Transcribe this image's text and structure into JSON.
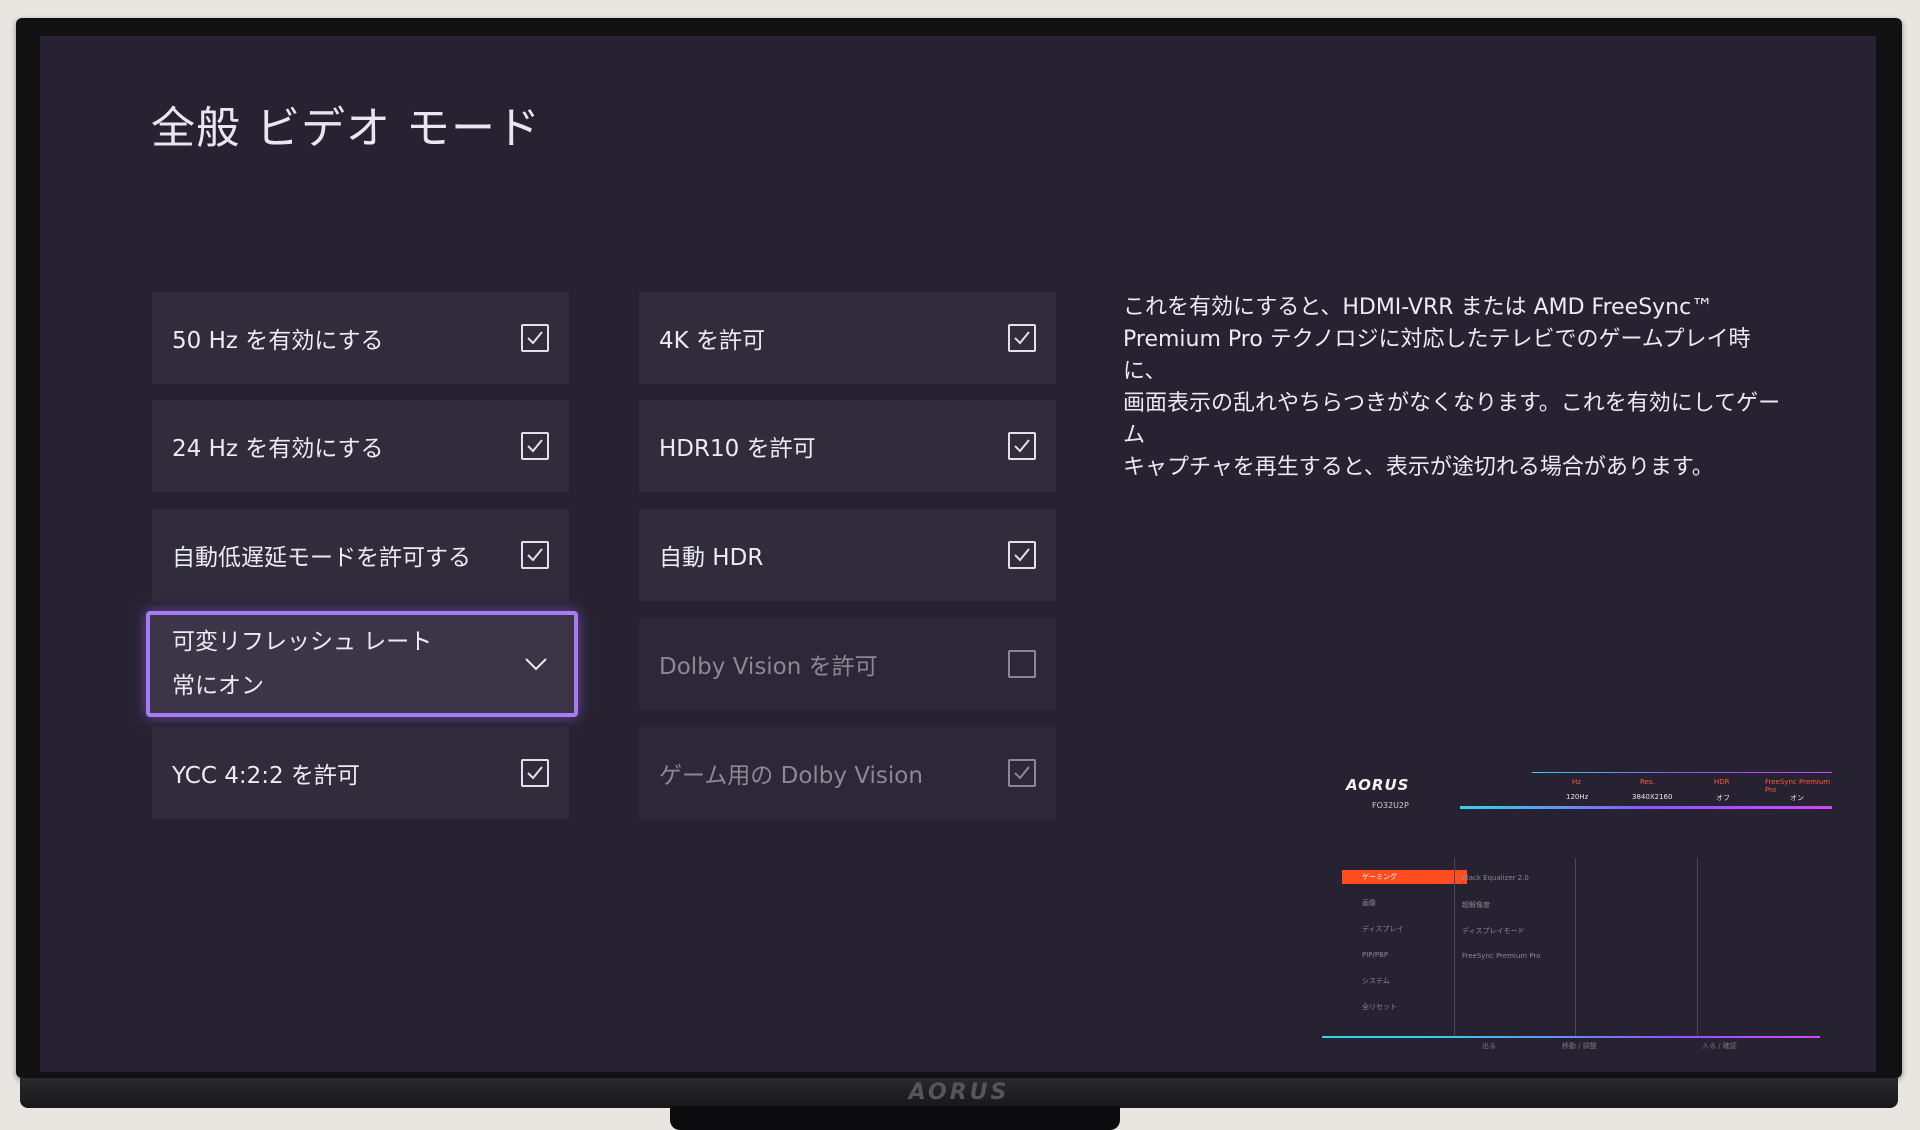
{
  "page": {
    "title": "全般 ビデオ モード"
  },
  "left_column": [
    {
      "label": "50 Hz を有効にする",
      "checked": true
    },
    {
      "label": "24 Hz を有効にする",
      "checked": true
    },
    {
      "label": "自動低遅延モードを許可する",
      "checked": true
    }
  ],
  "vrr_dropdown": {
    "label": "可変リフレッシュ レート",
    "value": "常にオン"
  },
  "ycc_option": {
    "label": "YCC 4:2:2 を許可",
    "checked": true
  },
  "right_column": [
    {
      "label": "4K を許可",
      "checked": true
    },
    {
      "label": "HDR10 を許可",
      "checked": true
    },
    {
      "label": "自動 HDR",
      "checked": true
    },
    {
      "label": "Dolby Vision を許可",
      "checked": false,
      "disabled": true
    },
    {
      "label": "ゲーム用の Dolby Vision",
      "checked": true,
      "disabled": true
    }
  ],
  "description": {
    "lines": [
      "これを有効にすると、HDMI-VRR または AMD FreeSync™",
      "Premium Pro テクノロジに対応したテレビでのゲームプレイ時に、",
      "画面表示の乱れやちらつきがなくなります。これを有効にしてゲーム",
      "キャプチャを再生すると、表示が途切れる場合があります。"
    ]
  },
  "monitor": {
    "brand": "AORUS",
    "osd": {
      "logo": "AORUS",
      "model": "FO32U2P",
      "status_headers": [
        "Hz",
        "Res.",
        "HDR",
        "FreeSync Premium Pro"
      ],
      "status_values": [
        "120Hz",
        "3840X2160",
        "オフ",
        "オン"
      ],
      "menu": [
        "ゲーミング",
        "画像",
        "ディスプレイ",
        "PIP/PBP",
        "システム",
        "全リセット"
      ],
      "options": [
        "Black Equalizer 2.0",
        "超解像度",
        "ディスプレイモード",
        "FreeSync Premium Pro"
      ],
      "hints": [
        "出る",
        "移動 / 調整",
        "入る / 確認"
      ]
    }
  },
  "colors": {
    "screen_bg": "#262231",
    "tile_bg": "#302c3b",
    "focus_outline": "#a97bf2",
    "osd_accent": "#ff4d1f"
  }
}
